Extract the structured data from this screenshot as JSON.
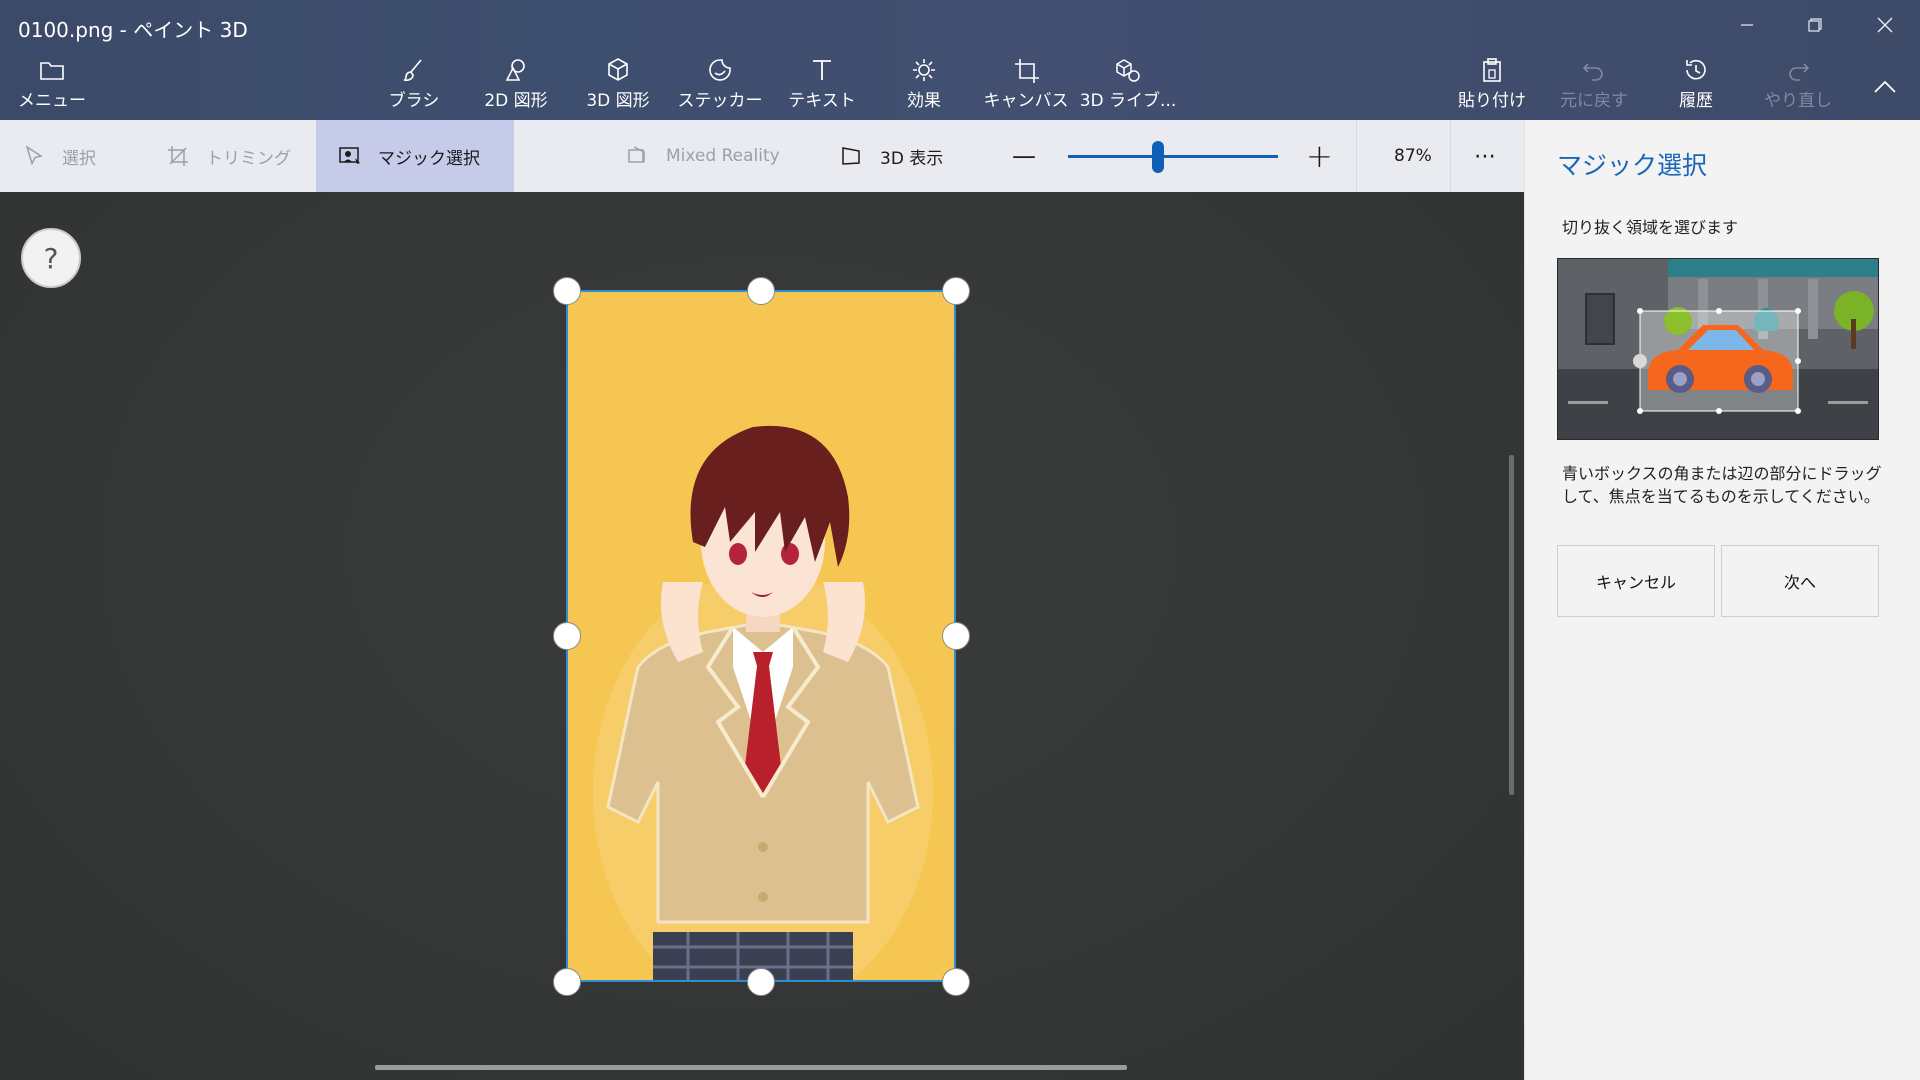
{
  "window": {
    "title": "0100.png - ペイント 3D",
    "minimize_icon": "minimize-icon",
    "restore_icon": "restore-icon",
    "close_icon": "close-icon"
  },
  "ribbon": {
    "menu": "メニュー",
    "items": [
      {
        "label": "ブラシ",
        "icon": "brush-icon"
      },
      {
        "label": "2D 図形",
        "icon": "2d-shapes-icon"
      },
      {
        "label": "3D 図形",
        "icon": "3d-shapes-icon"
      },
      {
        "label": "ステッカー",
        "icon": "sticker-icon"
      },
      {
        "label": "テキスト",
        "icon": "text-icon"
      },
      {
        "label": "効果",
        "icon": "effects-icon"
      },
      {
        "label": "キャンバス",
        "icon": "canvas-icon"
      },
      {
        "label": "3D ライブ...",
        "icon": "3d-library-icon"
      }
    ],
    "paste": "貼り付け",
    "undo": "元に戻す",
    "history": "履歴",
    "redo": "やり直し"
  },
  "toolbar": {
    "select": "選択",
    "crop": "トリミング",
    "magic_select": "マジック選択",
    "mixed_reality": "Mixed Reality",
    "view_3d": "3D 表示",
    "zoom_minus": "—",
    "zoom_plus": "+",
    "zoom_level": "87%",
    "zoom_value": 0.43,
    "more": "⋯"
  },
  "canvas": {
    "help": "?"
  },
  "panel": {
    "title": "マジック選択",
    "subtitle": "切り抜く領域を選びます",
    "description": "青いボックスの角または辺の部分にドラッグして、焦点を当てるものを示してください。",
    "cancel": "キャンセル",
    "next": "次へ"
  },
  "colors": {
    "accent": "#0f5fb6",
    "canvas_bg": "#f6c652",
    "panel_title": "#1a66b8"
  }
}
